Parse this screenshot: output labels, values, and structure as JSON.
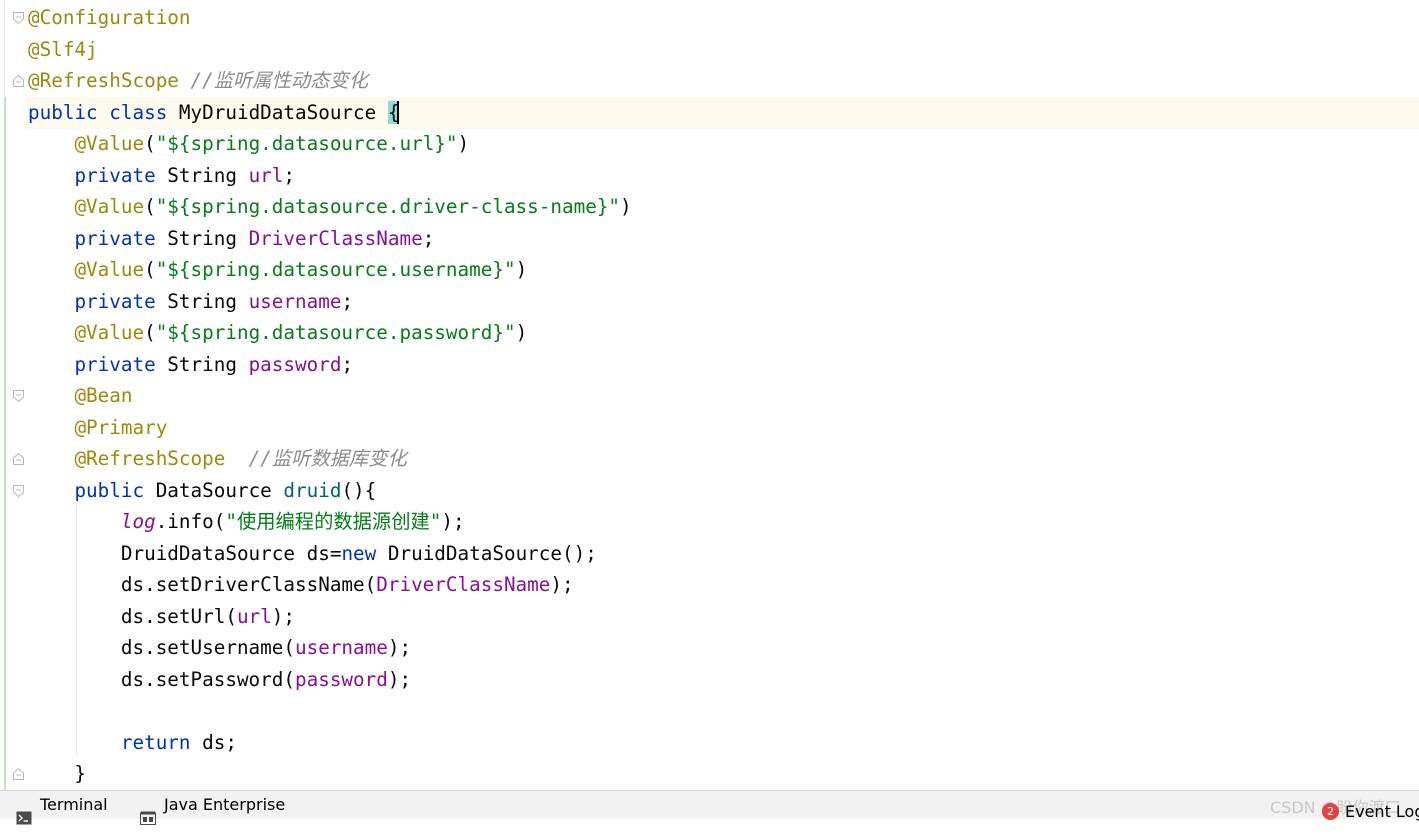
{
  "editor": {
    "lines": [
      [
        [
          "ann",
          "@Configuration"
        ]
      ],
      [
        [
          "ann",
          "@Slf4j"
        ]
      ],
      [
        [
          "ann",
          "@RefreshScope"
        ],
        [
          "t",
          " "
        ],
        [
          "cm",
          "//监听属性动态变化"
        ]
      ],
      [
        [
          "k",
          "public"
        ],
        [
          "t",
          " "
        ],
        [
          "k",
          "class"
        ],
        [
          "t",
          " MyDruidDataSource "
        ],
        [
          "bh",
          "{"
        ]
      ],
      [
        [
          "t",
          "    "
        ],
        [
          "ann",
          "@Value"
        ],
        [
          "t",
          "("
        ],
        [
          "s",
          "\"${spring.datasource.url}\""
        ],
        [
          "t",
          ")"
        ]
      ],
      [
        [
          "t",
          "    "
        ],
        [
          "k",
          "private"
        ],
        [
          "t",
          " String "
        ],
        [
          "f",
          "url"
        ],
        [
          "t",
          ";"
        ]
      ],
      [
        [
          "t",
          "    "
        ],
        [
          "ann",
          "@Value"
        ],
        [
          "t",
          "("
        ],
        [
          "s",
          "\"${spring.datasource.driver-class-name}\""
        ],
        [
          "t",
          ")"
        ]
      ],
      [
        [
          "t",
          "    "
        ],
        [
          "k",
          "private"
        ],
        [
          "t",
          " String "
        ],
        [
          "f",
          "DriverClassName"
        ],
        [
          "t",
          ";"
        ]
      ],
      [
        [
          "t",
          "    "
        ],
        [
          "ann",
          "@Value"
        ],
        [
          "t",
          "("
        ],
        [
          "s",
          "\"${spring.datasource.username}\""
        ],
        [
          "t",
          ")"
        ]
      ],
      [
        [
          "t",
          "    "
        ],
        [
          "k",
          "private"
        ],
        [
          "t",
          " String "
        ],
        [
          "f",
          "username"
        ],
        [
          "t",
          ";"
        ]
      ],
      [
        [
          "t",
          "    "
        ],
        [
          "ann",
          "@Value"
        ],
        [
          "t",
          "("
        ],
        [
          "s",
          "\"${spring.datasource.password}\""
        ],
        [
          "t",
          ")"
        ]
      ],
      [
        [
          "t",
          "    "
        ],
        [
          "k",
          "private"
        ],
        [
          "t",
          " String "
        ],
        [
          "f",
          "password"
        ],
        [
          "t",
          ";"
        ]
      ],
      [
        [
          "t",
          "    "
        ],
        [
          "ann",
          "@Bean"
        ]
      ],
      [
        [
          "t",
          "    "
        ],
        [
          "ann",
          "@Primary"
        ]
      ],
      [
        [
          "t",
          "    "
        ],
        [
          "ann",
          "@RefreshScope"
        ],
        [
          "t",
          "  "
        ],
        [
          "cm",
          "//监听数据库变化"
        ]
      ],
      [
        [
          "t",
          "    "
        ],
        [
          "k",
          "public"
        ],
        [
          "t",
          " DataSource "
        ],
        [
          "m",
          "druid"
        ],
        [
          "t",
          "(){"
        ]
      ],
      [
        [
          "t",
          "        "
        ],
        [
          "lg",
          "log"
        ],
        [
          "t",
          ".info("
        ],
        [
          "s",
          "\"使用编程的数据源创建\""
        ],
        [
          "t",
          ");"
        ]
      ],
      [
        [
          "t",
          "        DruidDataSource ds="
        ],
        [
          "k",
          "new"
        ],
        [
          "t",
          " DruidDataSource();"
        ]
      ],
      [
        [
          "t",
          "        ds.setDriverClassName("
        ],
        [
          "f",
          "DriverClassName"
        ],
        [
          "t",
          ");"
        ]
      ],
      [
        [
          "t",
          "        ds.setUrl("
        ],
        [
          "f",
          "url"
        ],
        [
          "t",
          ");"
        ]
      ],
      [
        [
          "t",
          "        ds.setUsername("
        ],
        [
          "f",
          "username"
        ],
        [
          "t",
          ");"
        ]
      ],
      [
        [
          "t",
          "        ds.setPassword("
        ],
        [
          "f",
          "password"
        ],
        [
          "t",
          ");"
        ]
      ],
      [],
      [
        [
          "t",
          "        "
        ],
        [
          "k",
          "return"
        ],
        [
          "t",
          " ds;"
        ]
      ],
      [
        [
          "t",
          "    }"
        ]
      ]
    ]
  },
  "statusbar": {
    "terminal_label": "Terminal",
    "java_enterprise_label": "Java Enterprise",
    "watermark": "CSDN @盼你渡口",
    "event_log_label": "Event Log",
    "event_log_count": "2"
  },
  "colors": {
    "keyword": "#0033b3",
    "annotation": "#9e880d",
    "string": "#067d17",
    "field": "#871094",
    "comment": "#8c8c8c",
    "method": "#00627a",
    "current_line": "#fcfaed",
    "brace_highlight": "#93d9d9"
  },
  "icons": {
    "fold_markers": "fold-arrow-icon",
    "terminal": "terminal-icon",
    "java_enterprise": "java-enterprise-icon",
    "event_log": "event-log-badge-icon"
  }
}
